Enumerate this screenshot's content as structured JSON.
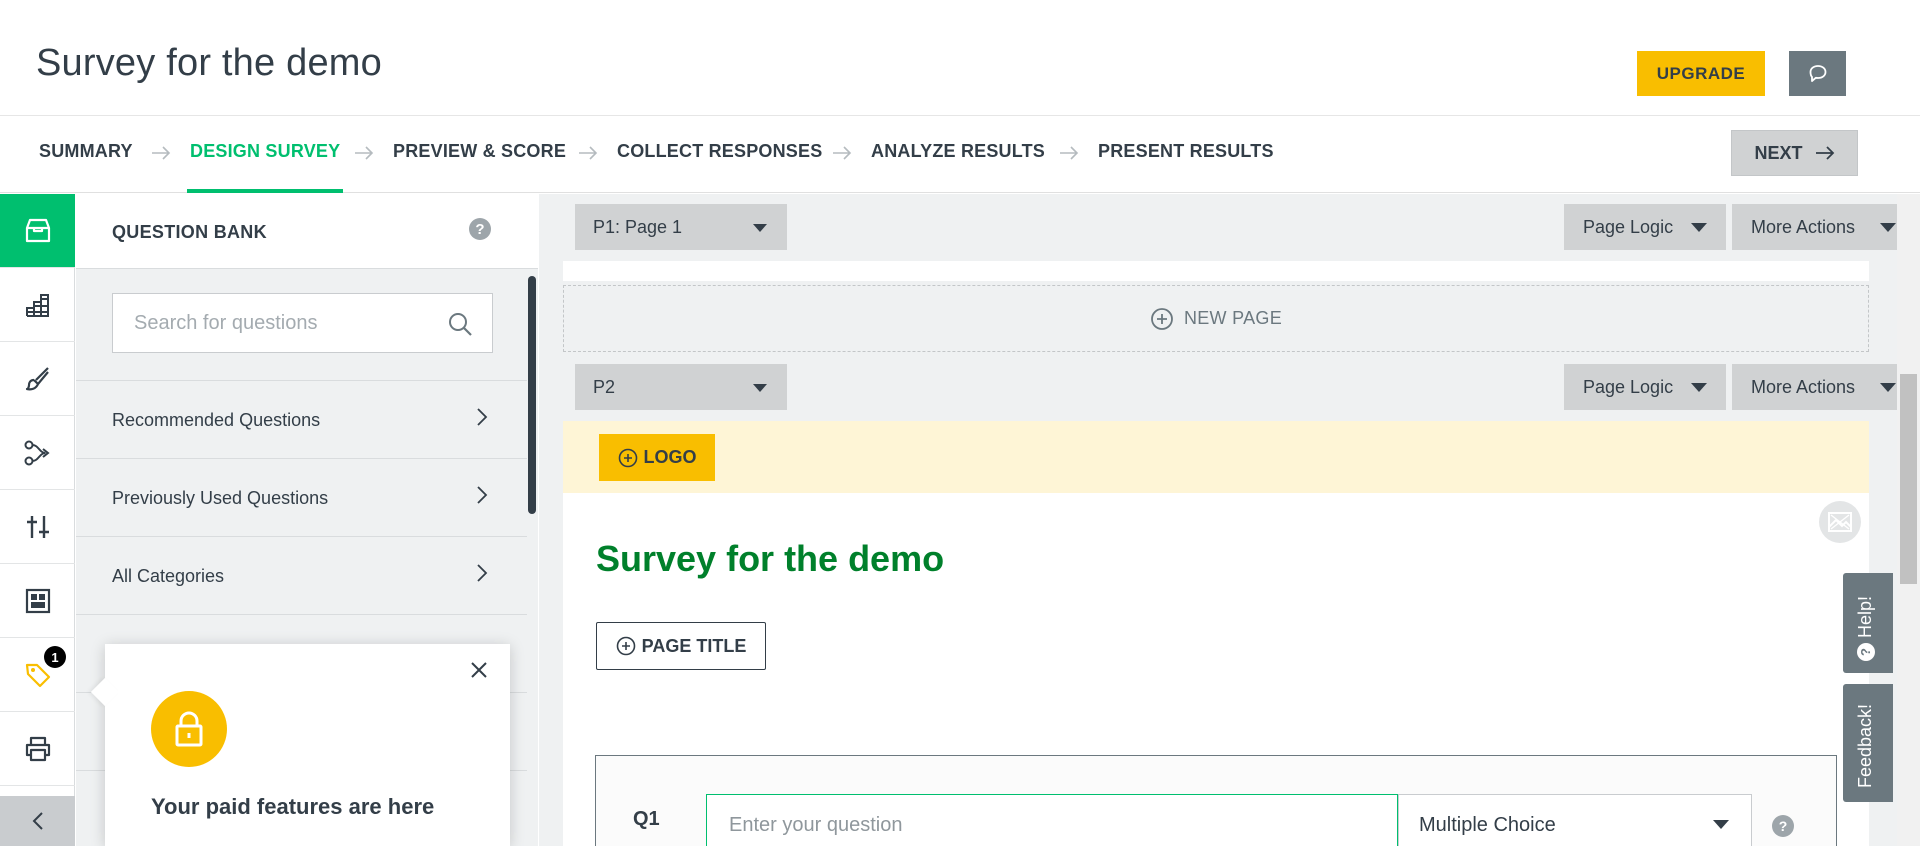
{
  "header": {
    "survey_title": "Survey for the demo",
    "upgrade_label": "UPGRADE",
    "feedback_icon": "speech-bubble-icon"
  },
  "steps": [
    {
      "label": "SUMMARY",
      "active": false
    },
    {
      "label": "DESIGN SURVEY",
      "active": true
    },
    {
      "label": "PREVIEW & SCORE",
      "active": false
    },
    {
      "label": "COLLECT RESPONSES",
      "active": false
    },
    {
      "label": "ANALYZE RESULTS",
      "active": false
    },
    {
      "label": "PRESENT RESULTS",
      "active": false
    }
  ],
  "next_label": "NEXT",
  "rail": {
    "items": [
      "question-bank-icon",
      "builder-icon",
      "brush-icon",
      "logic-icon",
      "options-icon",
      "layout-icon",
      "tag-icon",
      "print-icon"
    ],
    "badge": "1"
  },
  "question_bank": {
    "title": "QUESTION BANK",
    "help": "?",
    "search_placeholder": "Search for questions",
    "rows": [
      "Recommended Questions",
      "Previously Used Questions",
      "All Categories"
    ]
  },
  "popover": {
    "title": "Your paid features are here"
  },
  "canvas": {
    "page1_label": "P1: Page 1",
    "page2_label": "P2",
    "page_logic_label": "Page Logic",
    "more_actions_label": "More Actions",
    "new_page_label": "NEW PAGE",
    "logo_label": "LOGO",
    "body_title": "Survey for the demo",
    "page_title_label": "PAGE TITLE",
    "question": {
      "number": "Q1",
      "placeholder": "Enter your question",
      "type": "Multiple Choice",
      "help": "?"
    }
  },
  "side_tabs": {
    "help_label": "Help!",
    "feedback_label": "Feedback!"
  },
  "colors": {
    "accent_green": "#00bf6f",
    "title_green": "#00802b",
    "upgrade_yellow": "#f9be00",
    "dark_text": "#333e48"
  }
}
